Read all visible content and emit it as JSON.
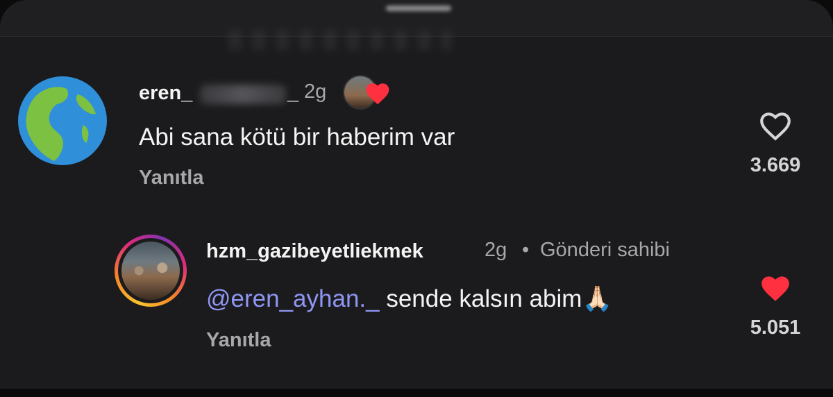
{
  "comments": [
    {
      "username": "eren_",
      "username_suffix": "_",
      "time": "2g",
      "text": "Abi sana kötü bir haberim var",
      "reply_label": "Yanıtla",
      "like_count": "3.669",
      "liked": false,
      "creator_liked": true
    },
    {
      "username": "hzm_gazibeyetliekmek",
      "time": "2g",
      "separator": "•",
      "author_badge": "Gönderi sahibi",
      "mention": "@eren_ayhan._",
      "text": " sende kalsın abim",
      "emoji": "🙏🏻",
      "reply_label": "Yanıtla",
      "like_count": "5.051",
      "liked": true
    }
  ],
  "colors": {
    "background": "#1b1b1d",
    "like_red": "#ff3040",
    "mention": "#8f96f3",
    "muted": "#a8a8ab"
  },
  "icons": [
    "globe-avatar-icon",
    "heart-outline-icon",
    "heart-filled-icon",
    "threads-mention-icon"
  ]
}
